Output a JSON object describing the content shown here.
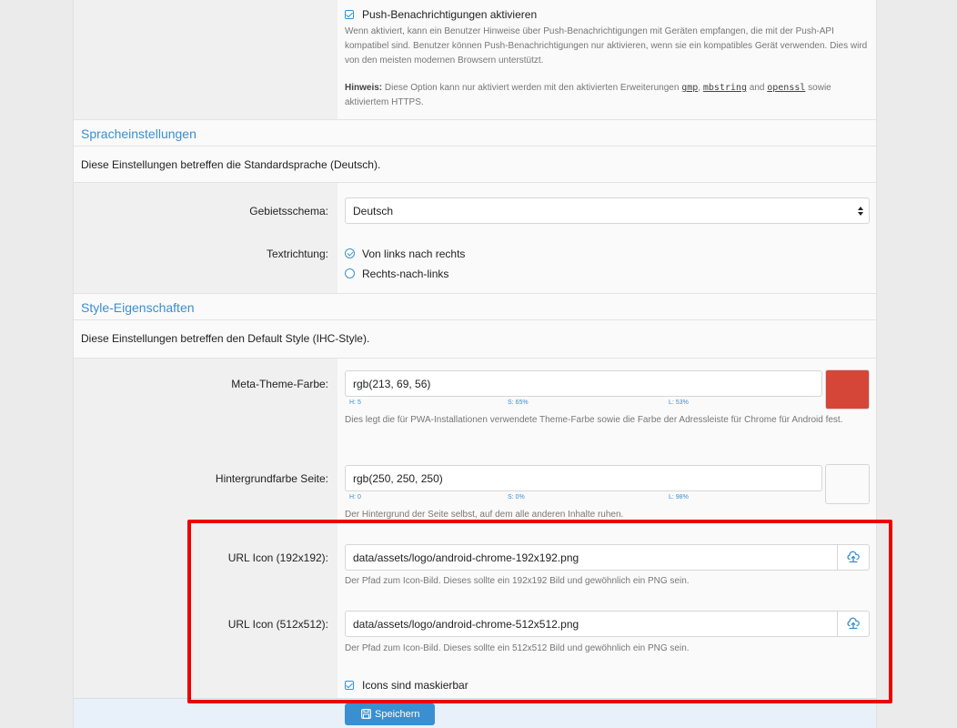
{
  "push": {
    "checkbox_label": "Push-Benachrichtigungen aktivieren",
    "description": "Wenn aktiviert, kann ein Benutzer Hinweise über Push-Benachrichtigungen mit Geräten empfangen, die mit der Push-API kompatibel sind. Benutzer können Push-Benachrichtigungen nur aktivieren, wenn sie ein kompatibles Gerät verwenden. Dies wird von den meisten modernen Browsern unterstützt.",
    "note_label": "Hinweis:",
    "note_text_1": "Diese Option kann nur aktiviert werden mit den aktivierten Erweiterungen",
    "ext_gmp": "gmp",
    "comma": ",",
    "ext_mbstring": "mbstring",
    "and": "and",
    "ext_openssl": "openssl",
    "note_text_2": "sowie aktiviertem HTTPS."
  },
  "language": {
    "title": "Spracheinstellungen",
    "description": "Diese Einstellungen betreffen die Standardsprache (Deutsch).",
    "locale_label": "Gebietsschema:",
    "locale_value": "Deutsch",
    "direction_label": "Textrichtung:",
    "direction_ltr": "Von links nach rechts",
    "direction_rtl": "Rechts-nach-links"
  },
  "style": {
    "title": "Style-Eigenschaften",
    "description": "Diese Einstellungen betreffen den Default Style (IHC-Style).",
    "theme_label": "Meta-Theme-Farbe:",
    "theme_value": "rgb(213, 69, 56)",
    "theme_h": "H: 5",
    "theme_s": "S: 65%",
    "theme_l": "L: 53%",
    "theme_color": "#d54538",
    "theme_help": "Dies legt die für PWA-Installationen verwendete Theme-Farbe sowie die Farbe der Adressleiste für Chrome für Android fest.",
    "bg_label": "Hintergrundfarbe Seite:",
    "bg_value": "rgb(250, 250, 250)",
    "bg_h": "H: 0",
    "bg_s": "S: 0%",
    "bg_l": "L: 98%",
    "bg_color": "#fafafa",
    "bg_help": "Der Hintergrund der Seite selbst, auf dem alle anderen Inhalte ruhen.",
    "icon192_label": "URL Icon (192x192):",
    "icon192_value": "data/assets/logo/android-chrome-192x192.png",
    "icon192_help": "Der Pfad zum Icon-Bild. Dieses sollte ein 192x192 Bild und gewöhnlich ein PNG sein.",
    "icon512_label": "URL Icon (512x512):",
    "icon512_value": "data/assets/logo/android-chrome-512x512.png",
    "icon512_help": "Der Pfad zum Icon-Bild. Dieses sollte ein 512x512 Bild und gewöhnlich ein PNG sein.",
    "maskable_label": "Icons sind maskierbar"
  },
  "footer": {
    "save_label": "Speichern"
  },
  "colors": {
    "accent": "#3a8fd0",
    "highlight": "#ee0000"
  }
}
